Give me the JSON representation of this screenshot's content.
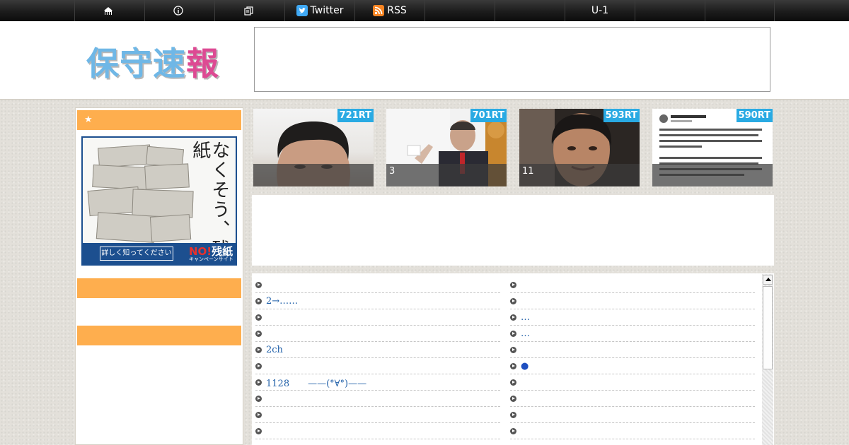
{
  "nav": {
    "items": [
      {
        "icon": "home-icon",
        "label": ""
      },
      {
        "icon": "info-icon",
        "label": ""
      },
      {
        "icon": "archive-icon",
        "label": ""
      },
      {
        "icon": "twitter-icon",
        "label": "Twitter"
      },
      {
        "icon": "rss-icon",
        "label": "RSS"
      },
      {
        "icon": "",
        "label": ""
      },
      {
        "icon": "",
        "label": ""
      },
      {
        "icon": "",
        "label": "U-1"
      },
      {
        "icon": "",
        "label": ""
      },
      {
        "icon": "",
        "label": ""
      },
      {
        "icon": "",
        "label": ""
      }
    ]
  },
  "header": {
    "logo_text_blue": "保守速",
    "logo_text_pink": "報"
  },
  "sidebar": {
    "heading_1": "★",
    "heading_2": "",
    "heading_3": "",
    "banner": {
      "vertical_text": "なくそう、残紙",
      "button": "詳しく知ってください",
      "brand_no": "NO!",
      "brand_word": "残紙",
      "site": "キャンペーンサイト"
    }
  },
  "ranking": [
    {
      "rt": "721RT",
      "caption": ""
    },
    {
      "rt": "701RT",
      "caption": "3"
    },
    {
      "rt": "593RT",
      "caption": "11"
    },
    {
      "rt": "590RT",
      "caption": ""
    }
  ],
  "headlines": {
    "left": [
      "",
      "2→……",
      "",
      "",
      "2ch",
      "",
      "1128　　——(°∀°)——",
      "",
      "",
      ""
    ],
    "right": [
      "",
      "",
      "…",
      "…",
      "",
      "●",
      "",
      "",
      "",
      ""
    ]
  },
  "colors": {
    "sidebar_heading": "#feae4e",
    "rt_badge": "#29aae3",
    "link": "#1f5fa8",
    "logo_blue": "#6fb7e6",
    "logo_pink": "#dd4a93"
  }
}
